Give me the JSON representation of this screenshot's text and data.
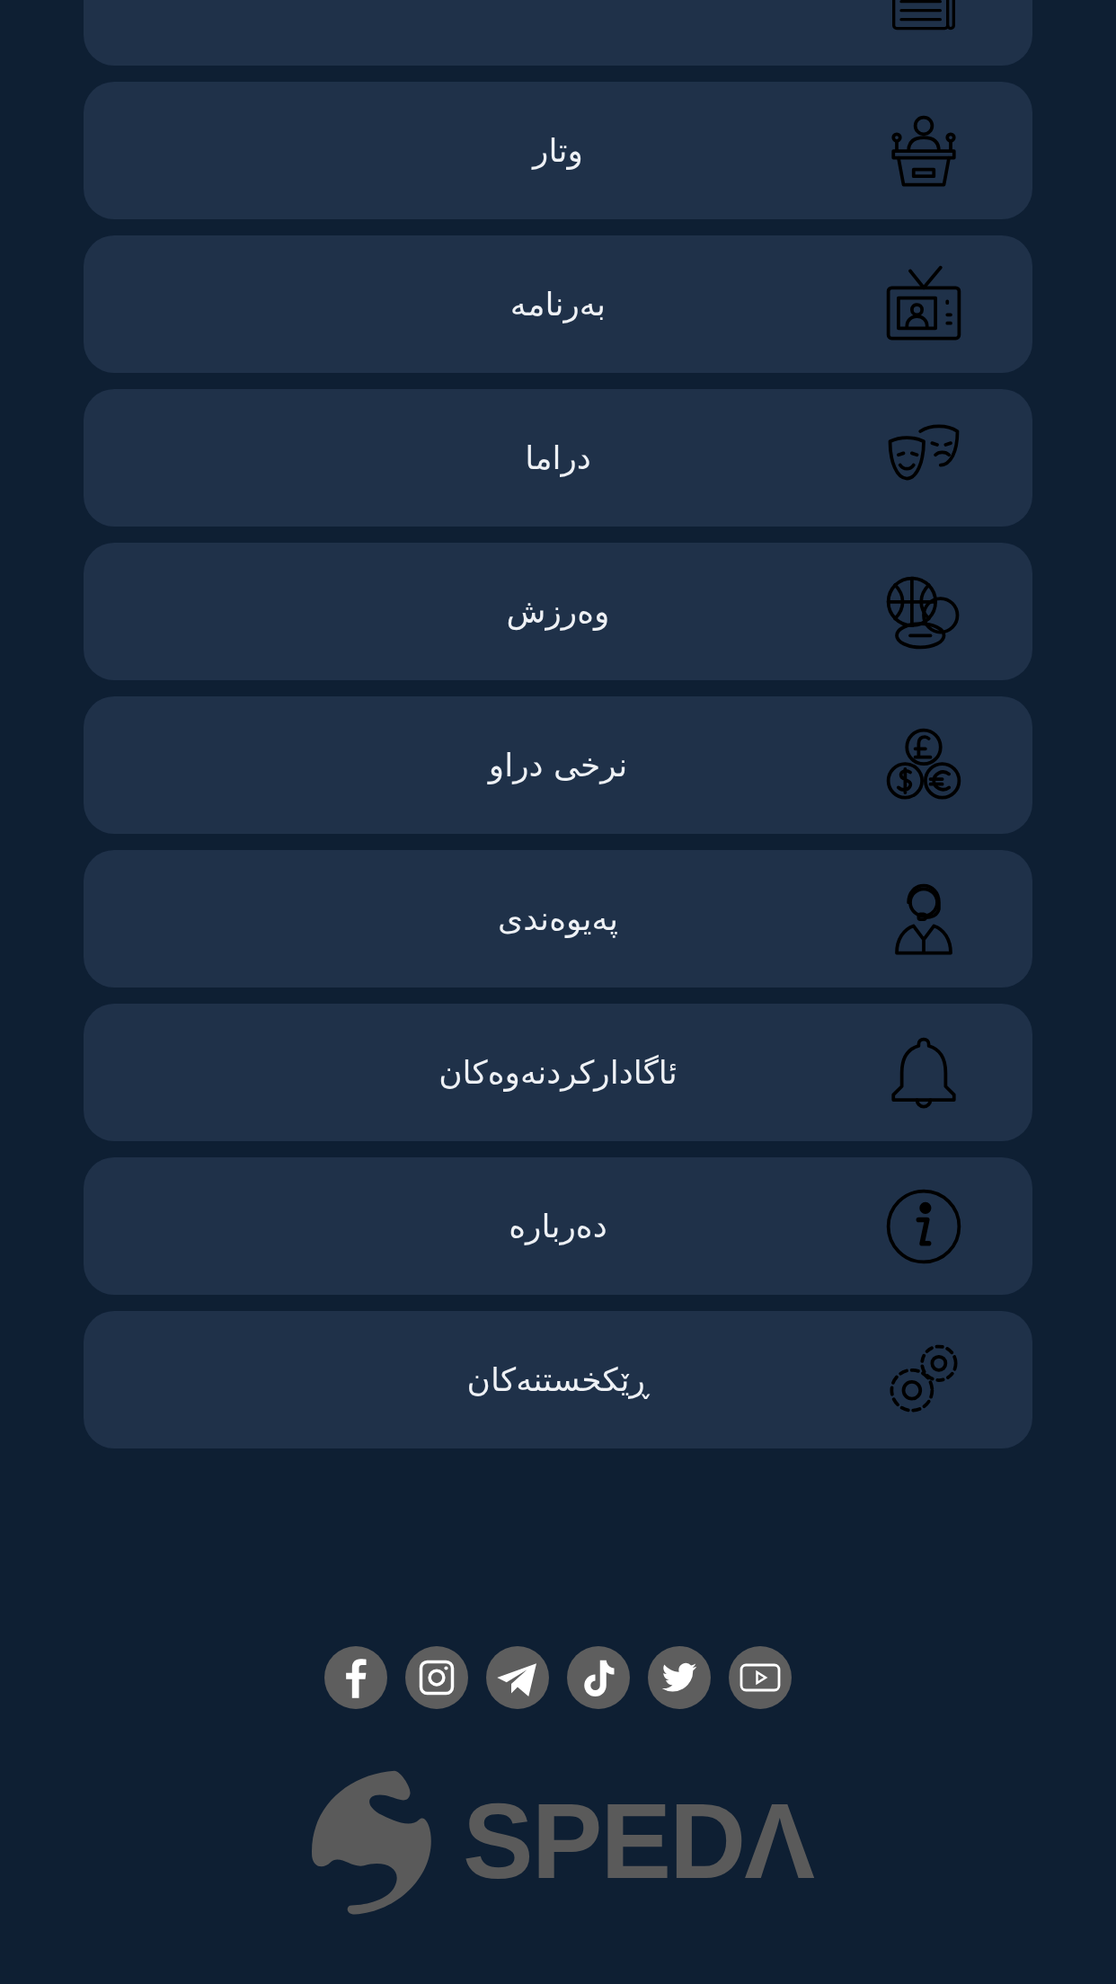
{
  "menu": [
    {
      "kind": "newspaper"
    },
    {
      "label": "وتار",
      "kind": "podium"
    },
    {
      "label": "بەرنامە",
      "kind": "tv"
    },
    {
      "label": "دراما",
      "kind": "masks"
    },
    {
      "label": "وەرزش",
      "kind": "balls"
    },
    {
      "label": "نرخی دراو",
      "kind": "coins"
    },
    {
      "label": "پەیوەندی",
      "kind": "support"
    },
    {
      "label": "ئاگادارکردنەوەکان",
      "kind": "bell"
    },
    {
      "label": "دەربارە",
      "kind": "info"
    },
    {
      "label": "ڕێکخستنەکان",
      "kind": "gears"
    }
  ],
  "social": [
    {
      "kind": "facebook"
    },
    {
      "kind": "instagram"
    },
    {
      "kind": "telegram"
    },
    {
      "kind": "tiktok"
    },
    {
      "kind": "twitter"
    },
    {
      "kind": "youtube"
    }
  ],
  "logo": {
    "text": "SPEDΛ"
  }
}
